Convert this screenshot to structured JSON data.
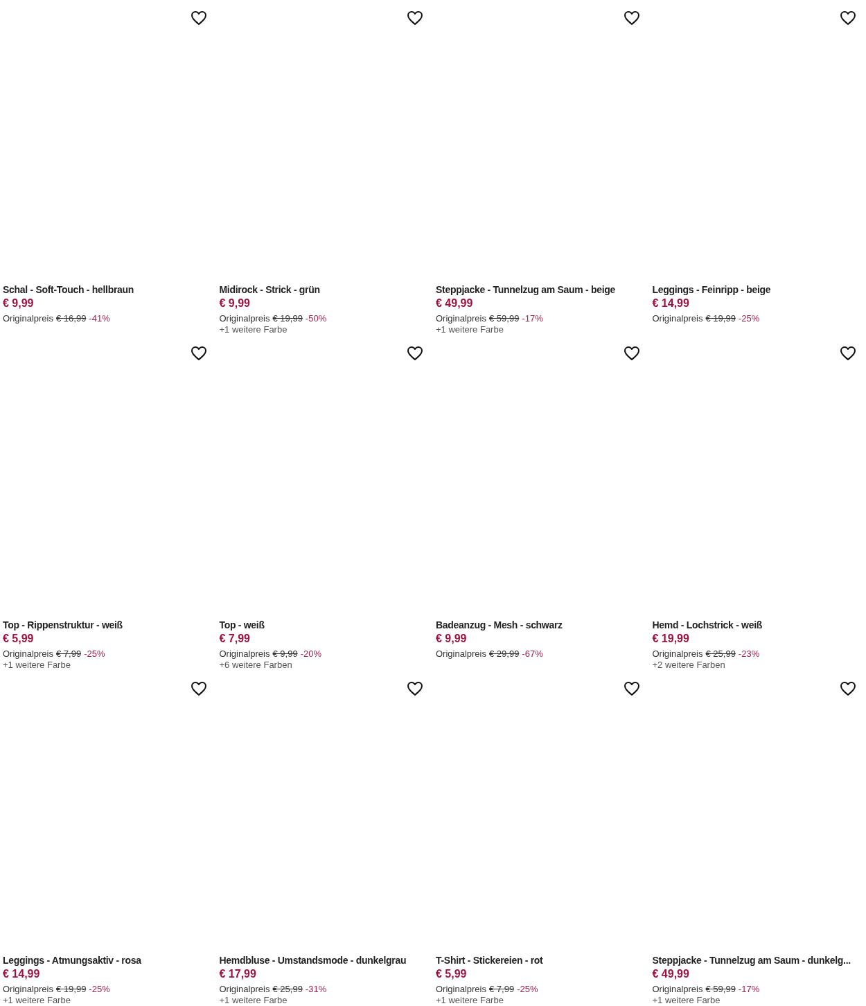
{
  "products": [
    {
      "title": "Schal - Soft-Touch - hellbraun",
      "price": "€ 9,99",
      "original_label": "Originalpreis",
      "original_price": "€ 16,99",
      "discount": "-41%"
    },
    {
      "title": "Midirock - Strick - grün",
      "price": "€ 9,99",
      "original_label": "Originalpreis",
      "original_price": "€ 19,99",
      "discount": "-50%",
      "more_colors": "+1 weitere Farbe"
    },
    {
      "title": "Steppjacke - Tunnelzug am Saum - beige",
      "price": "€ 49,99",
      "original_label": "Originalpreis",
      "original_price": "€ 59,99",
      "discount": "-17%",
      "more_colors": "+1 weitere Farbe"
    },
    {
      "title": "Leggings - Feinripp - beige",
      "price": "€ 14,99",
      "original_label": "Originalpreis",
      "original_price": "€ 19,99",
      "discount": "-25%"
    },
    {
      "title": "Top - Rippenstruktur - weiß",
      "price": "€ 5,99",
      "original_label": "Originalpreis",
      "original_price": "€ 7,99",
      "discount": "-25%",
      "more_colors": "+1 weitere Farbe"
    },
    {
      "title": "Top - weiß",
      "price": "€ 7,99",
      "original_label": "Originalpreis",
      "original_price": "€ 9,99",
      "discount": "-20%",
      "more_colors": "+6 weitere Farben"
    },
    {
      "title": "Badeanzug - Mesh - schwarz",
      "price": "€ 9,99",
      "original_label": "Originalpreis",
      "original_price": "€ 29,99",
      "discount": "-67%"
    },
    {
      "title": "Hemd - Lochstrick - weiß",
      "price": "€ 19,99",
      "original_label": "Originalpreis",
      "original_price": "€ 25,99",
      "discount": "-23%",
      "more_colors": "+2 weitere Farben"
    },
    {
      "title": "Leggings - Atmungsaktiv - rosa",
      "price": "€ 14,99",
      "original_label": "Originalpreis",
      "original_price": "€ 19,99",
      "discount": "-25%",
      "more_colors": "+1 weitere Farbe"
    },
    {
      "title": "Hemdbluse - Umstandsmode - dunkelgrau",
      "price": "€ 17,99",
      "original_label": "Originalpreis",
      "original_price": "€ 25,99",
      "discount": "-31%",
      "more_colors": "+1 weitere Farbe"
    },
    {
      "title": "T-Shirt - Stickereien - rot",
      "price": "€ 5,99",
      "original_label": "Originalpreis",
      "original_price": "€ 7,99",
      "discount": "-25%",
      "more_colors": "+1 weitere Farbe"
    },
    {
      "title": "Steppjacke - Tunnelzug am Saum - dunkelg...",
      "price": "€ 49,99",
      "original_label": "Originalpreis",
      "original_price": "€ 59,99",
      "discount": "-17%",
      "more_colors": "+1 weitere Farbe"
    }
  ]
}
